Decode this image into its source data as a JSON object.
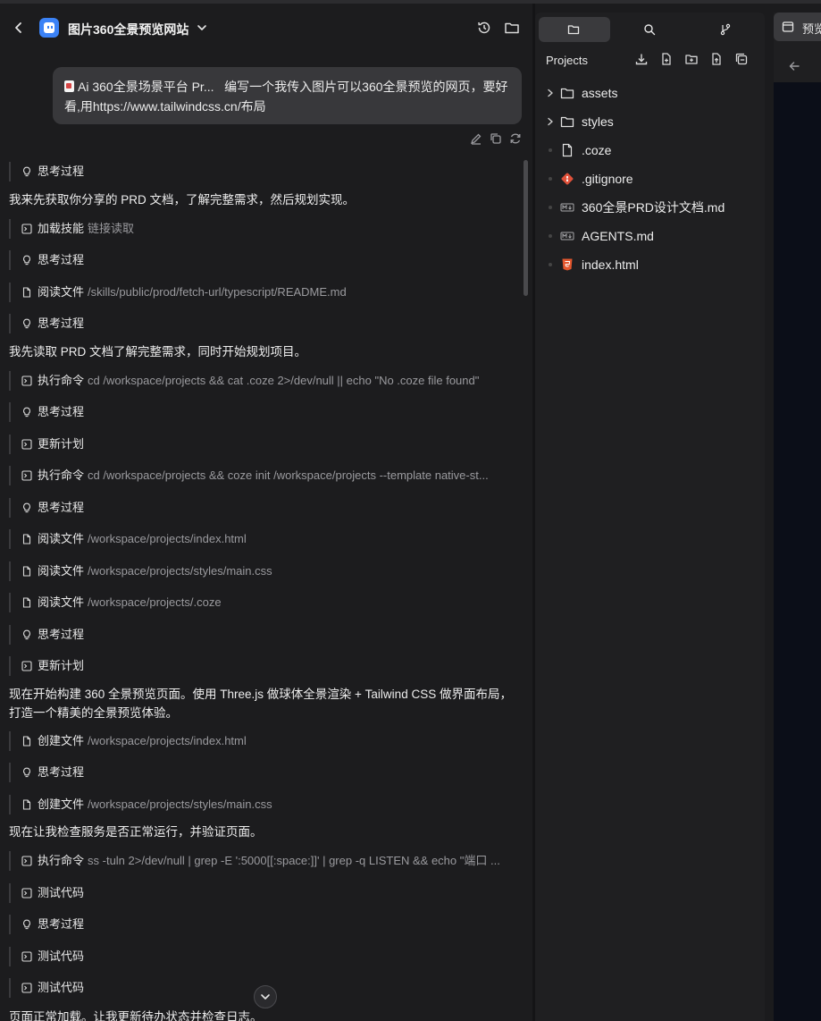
{
  "chat": {
    "title": "图片360全景预览网站",
    "user_message": {
      "attachment": "Ai 360全景场景平台 Pr...",
      "text": "编写一个我传入图片可以360全景预览的网页，要好看,用https://www.tailwindcss.cn/布局"
    },
    "steps": [
      {
        "label": "思考过程",
        "path": ""
      },
      {
        "label": "加载技能",
        "path": "链接读取"
      },
      {
        "label": "思考过程",
        "path": ""
      },
      {
        "label": "阅读文件",
        "path": "/skills/public/prod/fetch-url/typescript/README.md"
      },
      {
        "label": "思考过程",
        "path": ""
      },
      {
        "label": "执行命令",
        "path": "cd /workspace/projects && cat .coze 2>/dev/null || echo \"No .coze file found\""
      },
      {
        "label": "思考过程",
        "path": ""
      },
      {
        "label": "更新计划",
        "path": ""
      },
      {
        "label": "执行命令",
        "path": "cd /workspace/projects && coze init /workspace/projects --template native-st..."
      },
      {
        "label": "思考过程",
        "path": ""
      },
      {
        "label": "阅读文件",
        "path": "/workspace/projects/index.html"
      },
      {
        "label": "阅读文件",
        "path": "/workspace/projects/styles/main.css"
      },
      {
        "label": "阅读文件",
        "path": "/workspace/projects/.coze"
      },
      {
        "label": "思考过程",
        "path": ""
      },
      {
        "label": "更新计划",
        "path": ""
      },
      {
        "label": "创建文件",
        "path": "/workspace/projects/index.html"
      },
      {
        "label": "思考过程",
        "path": ""
      },
      {
        "label": "创建文件",
        "path": "/workspace/projects/styles/main.css"
      },
      {
        "label": "执行命令",
        "path": "ss -tuln 2>/dev/null | grep -E ':5000[[:space:]]' | grep -q LISTEN && echo \"端口 ..."
      },
      {
        "label": "测试代码",
        "path": ""
      },
      {
        "label": "思考过程",
        "path": ""
      },
      {
        "label": "测试代码",
        "path": ""
      },
      {
        "label": "测试代码",
        "path": ""
      }
    ],
    "paragraphs": [
      "我来先获取你分享的 PRD 文档，了解完整需求，然后规划实现。",
      "我先读取 PRD 文档了解完整需求，同时开始规划项目。",
      "现在开始构建 360 全景预览页面。使用 Three.js 做球体全景渲染 + Tailwind CSS 做界面布局，打造一个精美的全景预览体验。",
      "现在让我检查服务是否正常运行，并验证页面。",
      "页面正常加载。让我更新待办状态并检查日志。"
    ]
  },
  "files": {
    "projects_label": "Projects",
    "items": [
      {
        "name": "assets",
        "type": "folder"
      },
      {
        "name": "styles",
        "type": "folder"
      },
      {
        "name": ".coze",
        "type": "file"
      },
      {
        "name": ".gitignore",
        "type": "git"
      },
      {
        "name": "360全景PRD设计文档.md",
        "type": "md"
      },
      {
        "name": "AGENTS.md",
        "type": "md"
      },
      {
        "name": "index.html",
        "type": "html"
      }
    ]
  },
  "preview": {
    "tab_label": "预览"
  },
  "colors": {
    "background": "#1b1b1d",
    "bubble": "#38383b",
    "panel": "#1f1f21",
    "muted_text": "#9a9a9e",
    "preview_canvas": "#0b0e18",
    "git_icon": "#e0513a",
    "html_icon": "#e4572e"
  }
}
